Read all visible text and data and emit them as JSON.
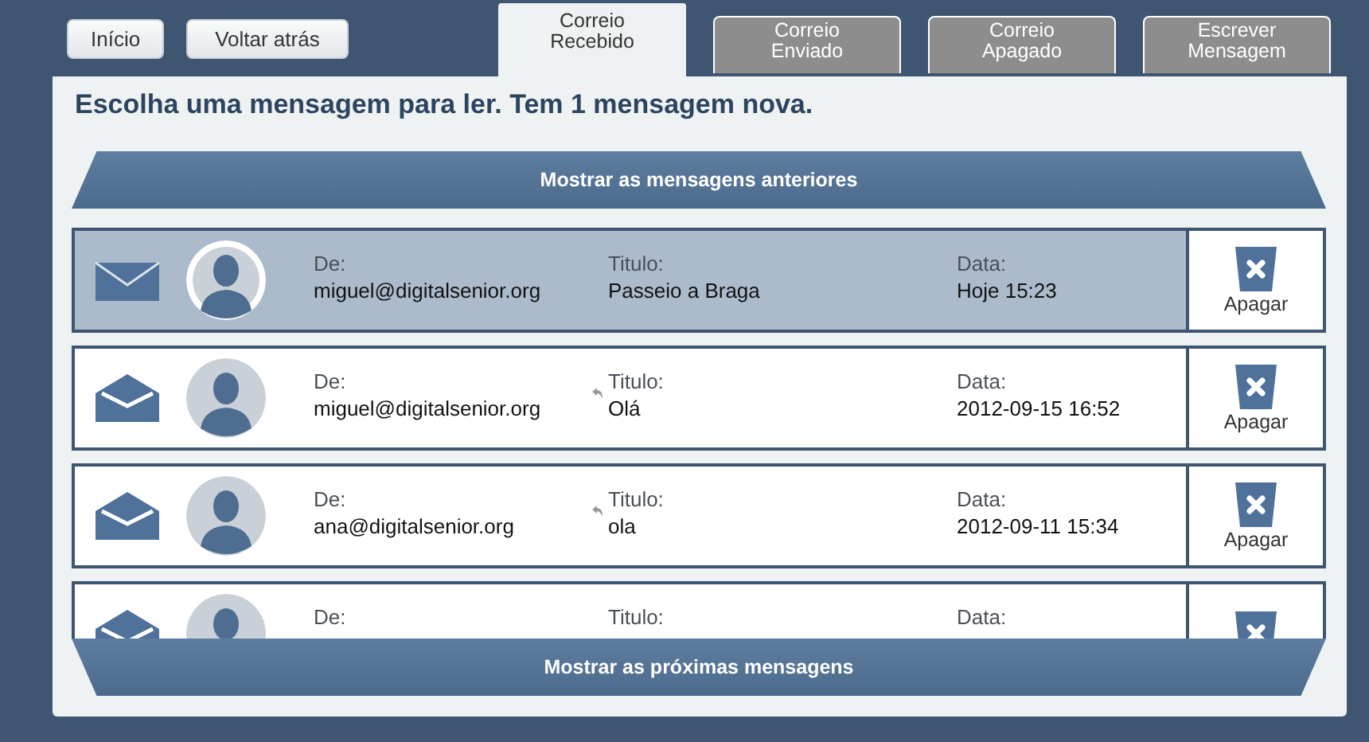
{
  "nav_buttons": [
    "Início",
    "Voltar atrás"
  ],
  "tabs": [
    {
      "label": "Correio Recebido",
      "selected": true
    },
    {
      "label": "Correio Enviado",
      "selected": false
    },
    {
      "label": "Correio Apagado",
      "selected": false
    },
    {
      "label": "Escrever Mensagem",
      "selected": false
    }
  ],
  "heading": "Escolha uma mensagem para ler. Tem 1 mensagem nova.",
  "previous_button": "Mostrar as mensagens anteriores",
  "messages": [
    {
      "selected": true,
      "unread": true,
      "replied": false,
      "from_label": "De:",
      "from": "miguel@digitalsenior.org",
      "title_label": "Titulo:",
      "title": "Passeio a Braga",
      "date_label": "Data:",
      "date": "Hoje 15:23",
      "delete": "Apagar"
    },
    {
      "selected": false,
      "unread": false,
      "replied": true,
      "from_label": "De:",
      "from": "miguel@digitalsenior.org",
      "title_label": "Titulo:",
      "title": "Olá",
      "date_label": "Data:",
      "date": "2012-09-15 16:52",
      "delete": "Apagar"
    },
    {
      "selected": false,
      "unread": false,
      "replied": true,
      "from_label": "De:",
      "from": "ana@digitalsenior.org",
      "title_label": "Titulo:",
      "title": "ola",
      "date_label": "Data:",
      "date": "2012-09-11 15:34",
      "delete": "Apagar"
    },
    {
      "selected": false,
      "unread": false,
      "replied": false,
      "from_label": "De:",
      "title_label": "Titulo:",
      "date_label": "Data:"
    }
  ],
  "next_button": "Mostrar as próximas mensagens"
}
